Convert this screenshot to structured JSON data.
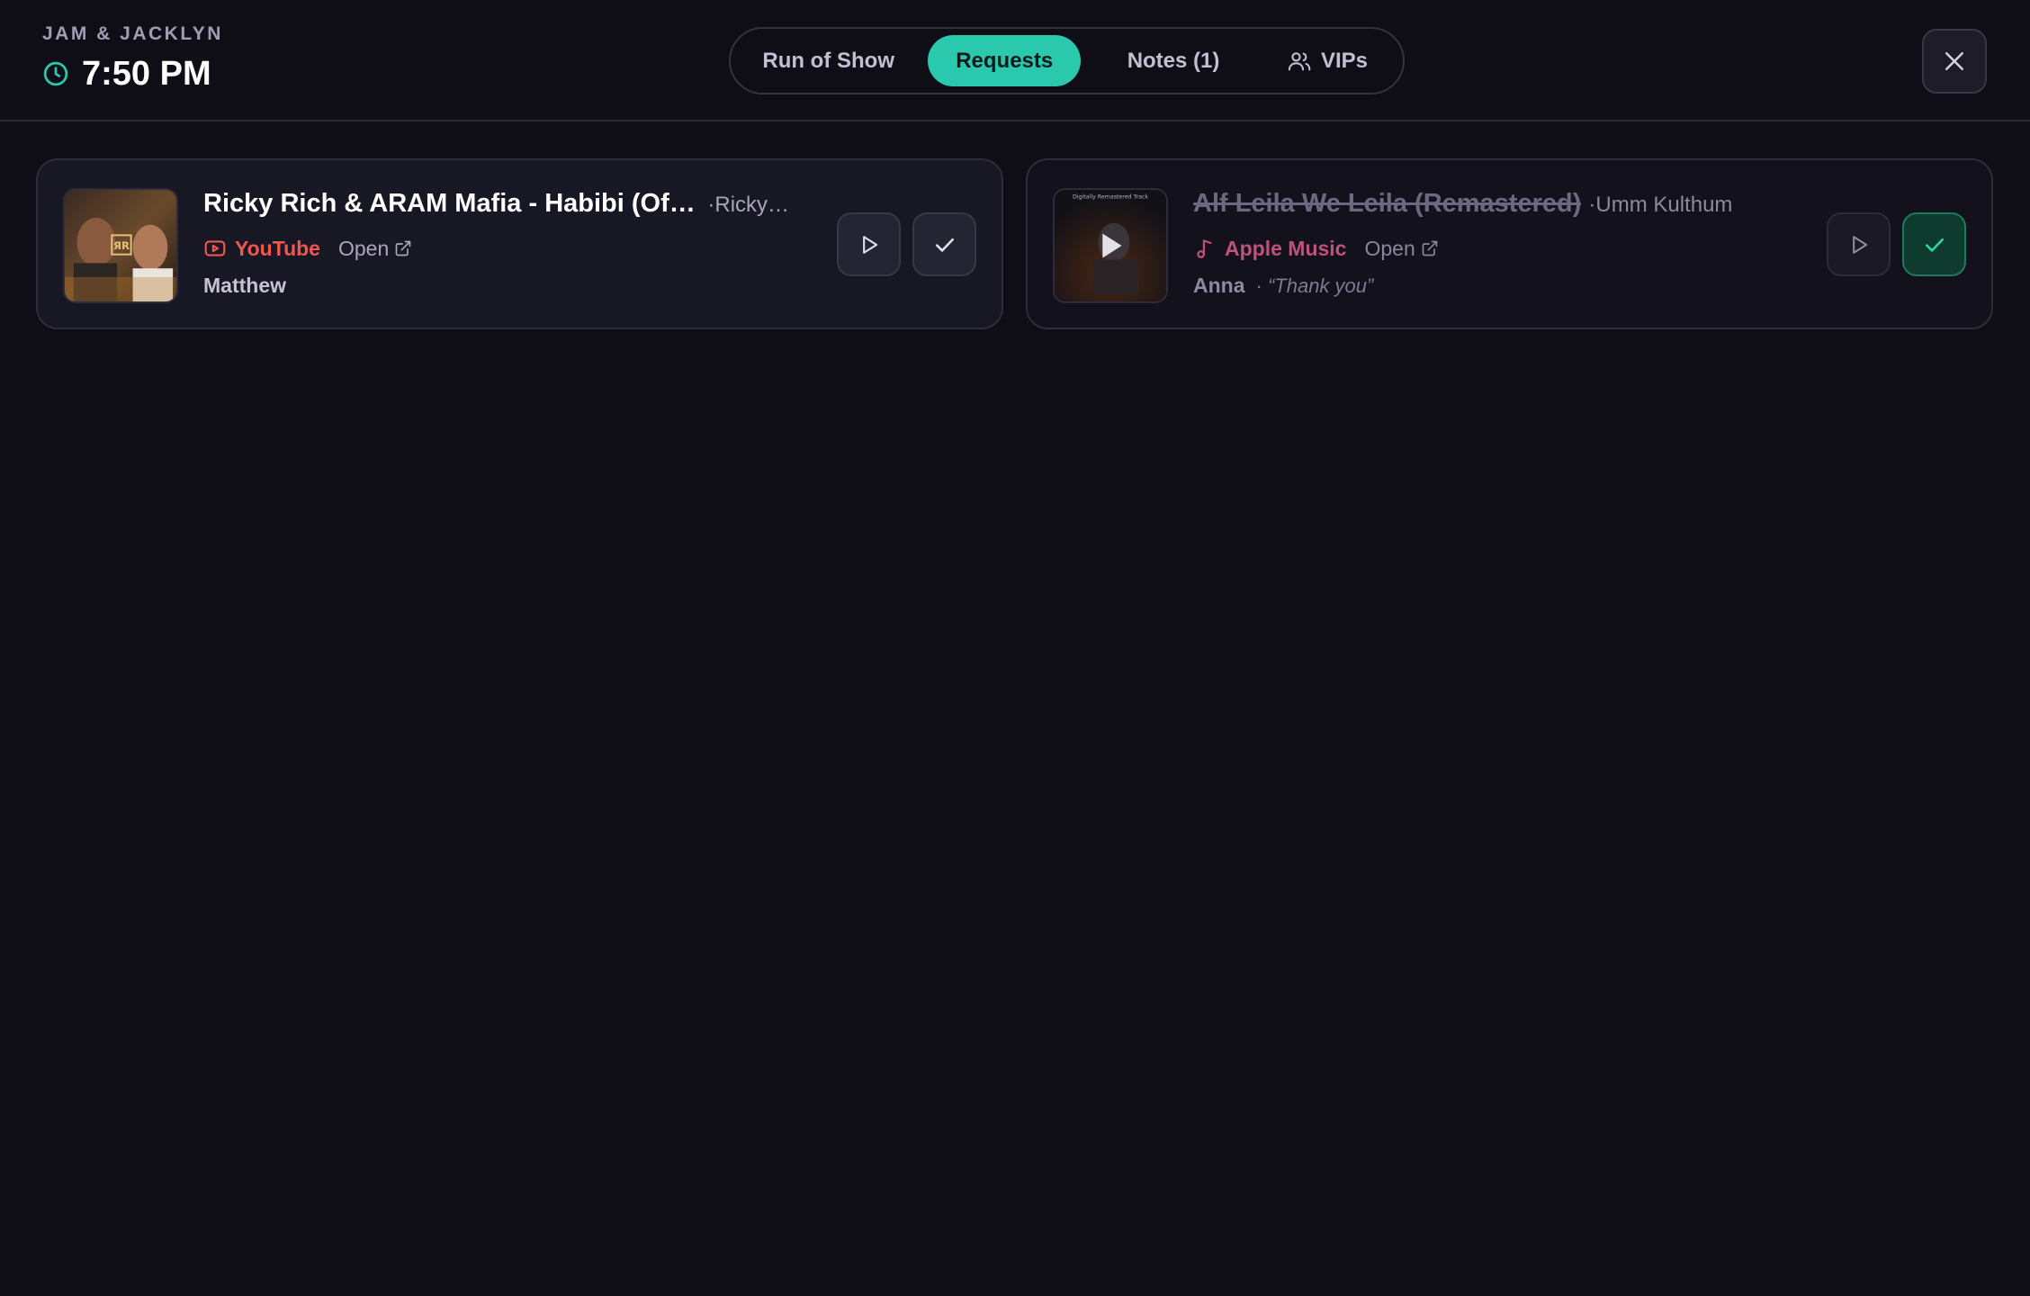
{
  "header": {
    "event_name": "JAM & JACKLYN",
    "time": "7:50 PM",
    "clock_icon": "clock-icon",
    "accent_color": "#2ac9ae"
  },
  "tabs": [
    {
      "label": "Run of Show",
      "active": false
    },
    {
      "label": "Requests",
      "active": true
    },
    {
      "label": "Notes (1)",
      "active": false
    },
    {
      "label": "VIPs",
      "active": false,
      "icon": "users-icon"
    }
  ],
  "close_icon": "close-icon",
  "requests": [
    {
      "title": "Ricky Rich & ARAM Mafia - Habibi (Off…",
      "artist": "Ricky …",
      "source": "YouTube",
      "source_icon": "youtube-icon",
      "source_color": "#f0574f",
      "open_label": "Open",
      "requester": "Matthew",
      "note": "",
      "played": false
    },
    {
      "title": "Alf Leila We Leila (Remastered)",
      "artist": "Umm Kulthum",
      "source": "Apple Music",
      "source_icon": "music-note-icon",
      "source_color": "#c0527a",
      "open_label": "Open",
      "requester": "Anna",
      "note": "“Thank you”",
      "played": true,
      "thumbnail_caption": "Digitally Remastered Track"
    }
  ]
}
